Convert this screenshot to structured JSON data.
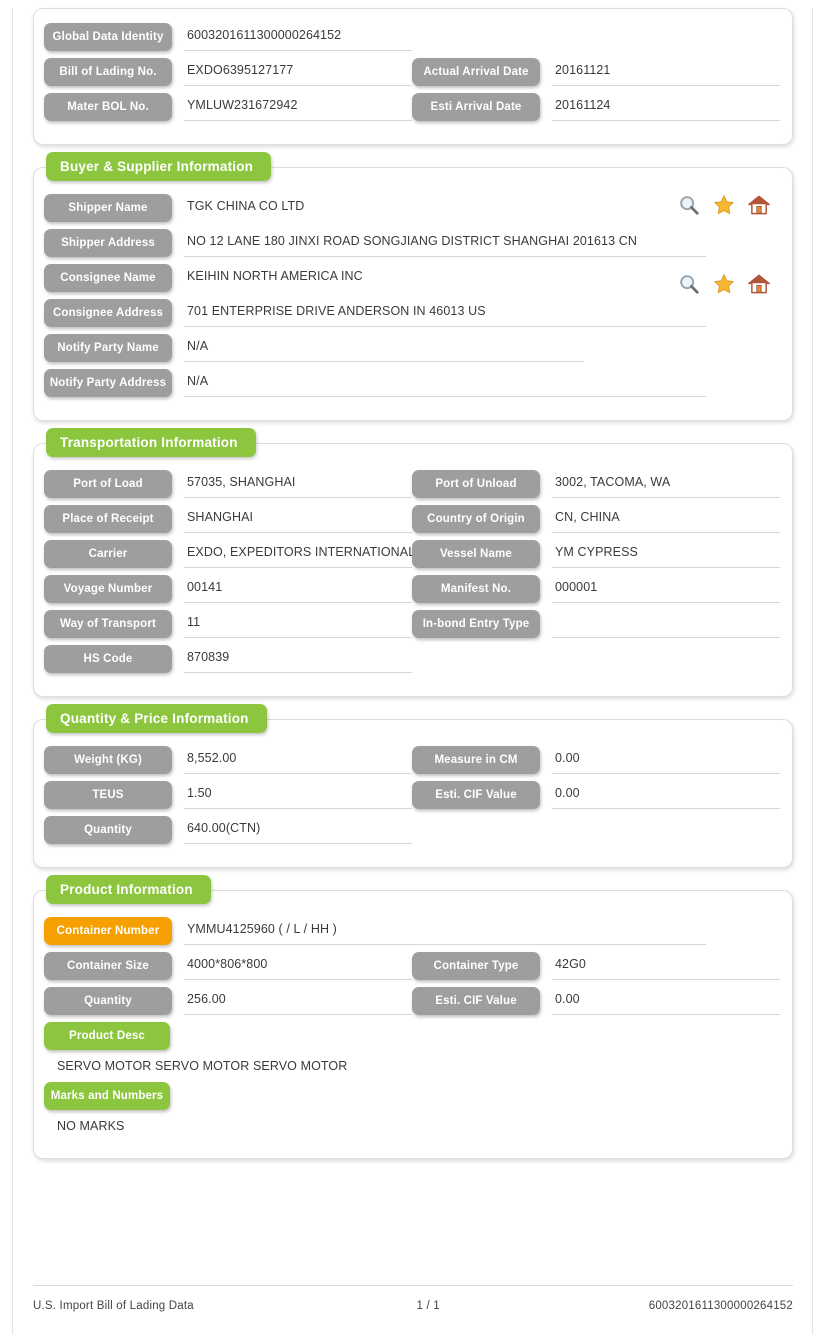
{
  "identity_panel": {
    "left_fields": [
      {
        "label": "Global Data Identity",
        "value": "6003201611300000264152"
      },
      {
        "label": "Bill of Lading No.",
        "value": "EXDO6395127177"
      },
      {
        "label": "Mater BOL No.",
        "value": "YMLUW231672942"
      }
    ],
    "right_fields": [
      {
        "label": "Actual Arrival Date",
        "value": "20161121"
      },
      {
        "label": "Esti Arrival Date",
        "value": "20161124"
      }
    ]
  },
  "buyer_supplier": {
    "title": "Buyer & Supplier Information",
    "fields": [
      {
        "label": "Shipper Name",
        "value": "TGK CHINA CO LTD"
      },
      {
        "label": "Shipper Address",
        "value": "NO 12 LANE 180 JINXI ROAD SONGJIANG DISTRICT SHANGHAI 201613 CN"
      },
      {
        "label": "Consignee Name",
        "value": "KEIHIN NORTH AMERICA INC"
      },
      {
        "label": "Consignee Address",
        "value": "701 ENTERPRISE DRIVE ANDERSON IN 46013 US"
      },
      {
        "label": "Notify Party Name",
        "value": "N/A"
      },
      {
        "label": "Notify Party Address",
        "value": "N/A"
      }
    ],
    "icons": [
      {
        "name": "search-icon",
        "title": "Search"
      },
      {
        "name": "star-icon",
        "title": "Favorite"
      },
      {
        "name": "home-icon",
        "title": "Home"
      }
    ]
  },
  "transportation": {
    "title": "Transportation Information",
    "left_fields": [
      {
        "label": "Port of Load",
        "value": "57035, SHANGHAI"
      },
      {
        "label": "Place of Receipt",
        "value": "SHANGHAI"
      },
      {
        "label": "Carrier",
        "value": "EXDO, EXPEDITORS INTERNATIONAL"
      },
      {
        "label": "Voyage Number",
        "value": "00141"
      },
      {
        "label": "Way of Transport",
        "value": "11"
      },
      {
        "label": "HS Code",
        "value": "870839"
      }
    ],
    "right_fields": [
      {
        "label": "Port of Unload",
        "value": "3002, TACOMA, WA"
      },
      {
        "label": "Country of Origin",
        "value": "CN, CHINA"
      },
      {
        "label": "Vessel Name",
        "value": "YM CYPRESS"
      },
      {
        "label": "Manifest No.",
        "value": "000001"
      },
      {
        "label": "In-bond Entry Type",
        "value": ""
      }
    ]
  },
  "quantity_price": {
    "title": "Quantity & Price Information",
    "left_fields": [
      {
        "label": "Weight (KG)",
        "value": "8,552.00"
      },
      {
        "label": "TEUS",
        "value": "1.50"
      },
      {
        "label": "Quantity",
        "value": "640.00(CTN)"
      }
    ],
    "right_fields": [
      {
        "label": "Measure in CM",
        "value": "0.00"
      },
      {
        "label": "Esti. CIF Value",
        "value": "0.00"
      }
    ]
  },
  "product": {
    "title": "Product Information",
    "container_number": {
      "label": "Container Number",
      "value": "YMMU4125960 ( / L / HH )"
    },
    "left_fields": [
      {
        "label": "Container Size",
        "value": "4000*806*800"
      },
      {
        "label": "Quantity",
        "value": "256.00"
      }
    ],
    "right_fields": [
      {
        "label": "Container Type",
        "value": "42G0"
      },
      {
        "label": "Esti. CIF Value",
        "value": "0.00"
      }
    ],
    "product_desc": {
      "label": "Product Desc",
      "value": "SERVO MOTOR SERVO MOTOR SERVO MOTOR"
    },
    "marks": {
      "label": "Marks and Numbers",
      "value": "NO MARKS"
    }
  },
  "footer": {
    "left": "U.S. Import Bill of Lading Data",
    "center": "1 / 1",
    "right": "6003201611300000264152"
  },
  "colors": {
    "green": "#8cc63e",
    "orange": "#f5a000",
    "grey_pill": "#9e9e9e",
    "underline": "#d6d6d6"
  }
}
